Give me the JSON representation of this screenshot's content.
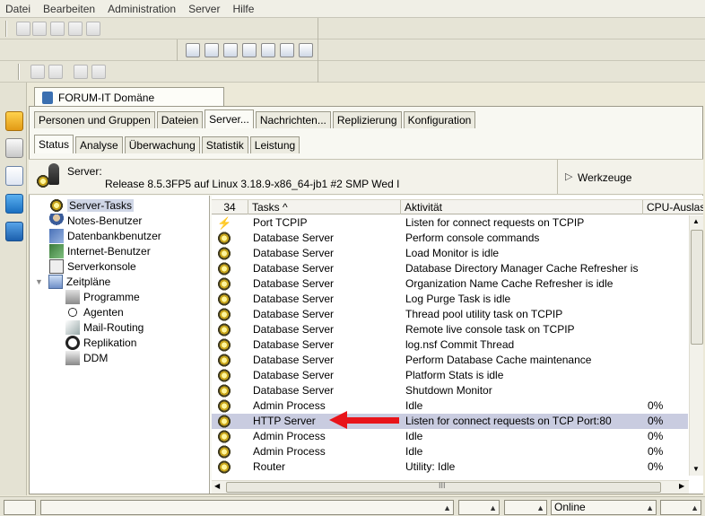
{
  "menu": [
    "Datei",
    "Bearbeiten",
    "Administration",
    "Server",
    "Hilfe"
  ],
  "doc_tab": {
    "title": "FORUM-IT Domäne"
  },
  "main_tabs": [
    "Personen und Gruppen",
    "Dateien",
    "Server...",
    "Nachrichten...",
    "Replizierung",
    "Konfiguration"
  ],
  "sub_tabs": [
    "Status",
    "Analyse",
    "Überwachung",
    "Statistik",
    "Leistung"
  ],
  "server": {
    "label": "Server:",
    "release": "Release 8.5.3FP5 auf Linux 3.18.9-x86_64-jb1 #2 SMP Wed I",
    "tools_label": "Werkzeuge"
  },
  "tree": [
    {
      "label": "Server-Tasks",
      "icon": "gear-icon"
    },
    {
      "label": "Notes-Benutzer",
      "icon": "user-icon"
    },
    {
      "label": "Datenbankbenutzer",
      "icon": "db-users-icon"
    },
    {
      "label": "Internet-Benutzer",
      "icon": "internet-users-icon"
    },
    {
      "label": "Serverkonsole",
      "icon": "console-icon"
    },
    {
      "label": "Zeitpläne",
      "icon": "calendar-icon"
    },
    {
      "label": "Programme",
      "icon": "programs-icon"
    },
    {
      "label": "Agenten",
      "icon": "agent-icon"
    },
    {
      "label": "Mail-Routing",
      "icon": "mail-routing-icon"
    },
    {
      "label": "Replikation",
      "icon": "replication-icon"
    },
    {
      "label": "DDM",
      "icon": "ddm-icon"
    }
  ],
  "table": {
    "count": "34",
    "headers": [
      "Tasks ^",
      "Aktivität",
      "CPU-Auslastu"
    ],
    "rows": [
      {
        "task": "Port TCPIP",
        "activity": "Listen for connect requests on TCPIP",
        "cpu": "",
        "icon": "lightning-icon"
      },
      {
        "task": "Database Server",
        "activity": "Perform console commands",
        "cpu": "",
        "icon": "gear-icon"
      },
      {
        "task": "Database Server",
        "activity": "Load Monitor is idle",
        "cpu": "",
        "icon": "gear-icon"
      },
      {
        "task": "Database Server",
        "activity": "Database Directory Manager Cache Refresher is",
        "cpu": "",
        "icon": "gear-icon"
      },
      {
        "task": "Database Server",
        "activity": "Organization Name Cache Refresher is idle",
        "cpu": "",
        "icon": "gear-icon"
      },
      {
        "task": "Database Server",
        "activity": "Log Purge Task is idle",
        "cpu": "",
        "icon": "gear-icon"
      },
      {
        "task": "Database Server",
        "activity": "Thread pool utility task on TCPIP",
        "cpu": "",
        "icon": "gear-icon"
      },
      {
        "task": "Database Server",
        "activity": "Remote live console task on TCPIP",
        "cpu": "",
        "icon": "gear-icon"
      },
      {
        "task": "Database Server",
        "activity": "log.nsf Commit Thread",
        "cpu": "",
        "icon": "gear-icon"
      },
      {
        "task": "Database Server",
        "activity": "Perform Database Cache maintenance",
        "cpu": "",
        "icon": "gear-icon"
      },
      {
        "task": "Database Server",
        "activity": "Platform Stats is idle",
        "cpu": "",
        "icon": "gear-icon"
      },
      {
        "task": "Database Server",
        "activity": "Shutdown Monitor",
        "cpu": "",
        "icon": "gear-icon"
      },
      {
        "task": "Admin Process",
        "activity": "Idle",
        "cpu": "0%",
        "icon": "gear-icon"
      },
      {
        "task": "HTTP Server",
        "activity": "Listen for connect requests on TCP Port:80",
        "cpu": "0%",
        "icon": "gear-icon",
        "selected": true
      },
      {
        "task": "Admin Process",
        "activity": "Idle",
        "cpu": "0%",
        "icon": "gear-icon"
      },
      {
        "task": "Admin Process",
        "activity": "Idle",
        "cpu": "0%",
        "icon": "gear-icon"
      },
      {
        "task": "Router",
        "activity": "Utility: Idle",
        "cpu": "0%",
        "icon": "gear-icon"
      }
    ]
  },
  "scroll_grip": "III",
  "status": {
    "online": "Online"
  },
  "colors": {
    "selection": "#c9cce0",
    "arrow": "#e8141a"
  }
}
